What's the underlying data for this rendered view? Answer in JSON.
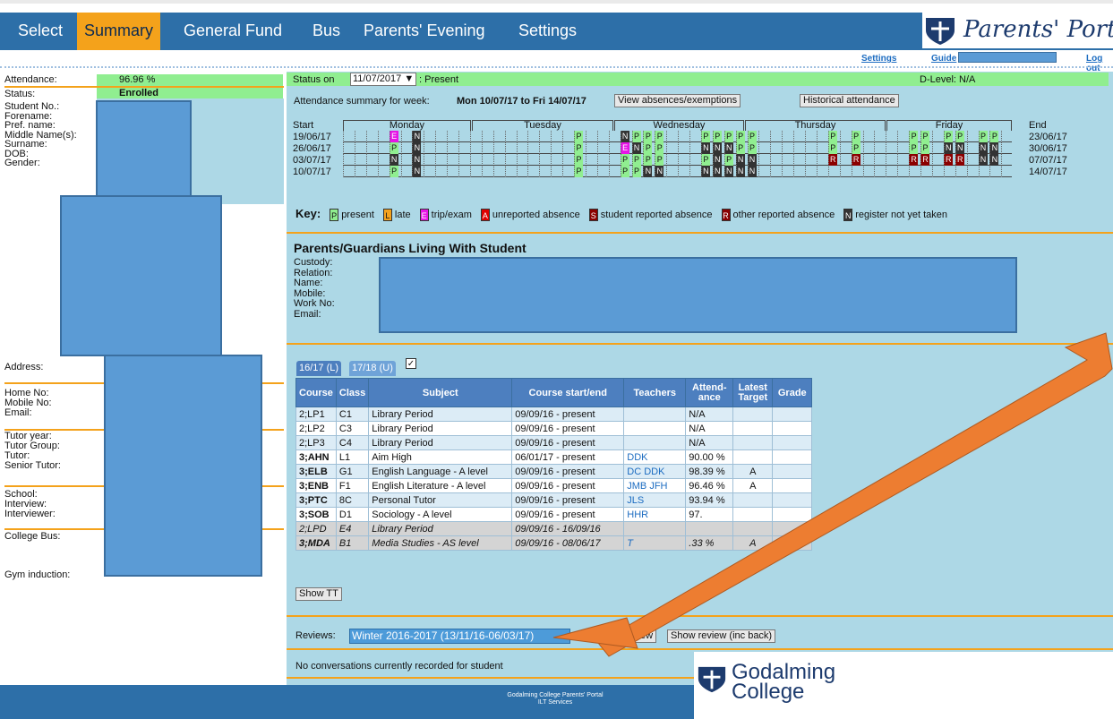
{
  "nav": {
    "items": [
      "Select",
      "Summary",
      "General Fund",
      "Bus",
      "Parents' Evening",
      "Settings"
    ],
    "active": "Summary"
  },
  "brand": {
    "title": "Parents' Portal"
  },
  "sublinks": {
    "settings": "Settings",
    "guide": "Guide",
    "logout": "Log out"
  },
  "student": {
    "attendance_label": "Attendance:",
    "attendance_value": "96.96 %",
    "status_label": "Status:",
    "status_value": "Enrolled",
    "labels1": [
      "Student No.:",
      "Forename:",
      "Pref. name:",
      "Middle Name(s):",
      "Surname:",
      "DOB:",
      "Gender:"
    ],
    "address_label": "Address:",
    "labels2": [
      "Home No:",
      "Mobile No:",
      "Email:",
      "Tutor year:",
      "Tutor Group:",
      "Tutor:",
      "Senior Tutor:",
      "School:",
      "Interview:",
      "Interviewer:",
      "College Bus:"
    ],
    "gym_label": "Gym induction:"
  },
  "status": {
    "prefix": "Status on",
    "date": "11/07/2017",
    "suffix": ": Present",
    "dlevel": "D-Level: N/A"
  },
  "attendance_summary": {
    "label": "Attendance summary for week:",
    "week": "Mon 10/07/17 to Fri 14/07/17",
    "btn_absences": "View absences/exemptions",
    "btn_historical": "Historical attendance"
  },
  "grid": {
    "start": "Start",
    "end": "End",
    "days": [
      "Monday",
      "Tuesday",
      "Wednesday",
      "Thursday",
      "Friday"
    ],
    "rows": [
      {
        "start": "19/06/17",
        "end": "23/06/17",
        "cells": {
          "4": "E",
          "6": "N",
          "20": "P",
          "24": "N",
          "25": "P",
          "26": "P",
          "27": "P",
          "31": "P",
          "32": "P",
          "33": "P",
          "34": "P",
          "35": "P",
          "42": "P",
          "44": "P",
          "49": "P",
          "50": "P",
          "52": "P",
          "53": "P",
          "55": "P",
          "56": "P"
        }
      },
      {
        "start": "26/06/17",
        "end": "30/06/17",
        "cells": {
          "4": "P",
          "6": "N",
          "20": "P",
          "24": "E",
          "25": "N",
          "26": "P",
          "27": "P",
          "31": "N",
          "32": "N",
          "33": "N",
          "34": "P",
          "35": "P",
          "42": "P",
          "44": "P",
          "49": "P",
          "50": "P",
          "52": "N",
          "53": "N",
          "55": "N",
          "56": "N"
        }
      },
      {
        "start": "03/07/17",
        "end": "07/07/17",
        "cells": {
          "4": "N",
          "6": "N",
          "20": "P",
          "24": "P",
          "25": "P",
          "26": "P",
          "27": "P",
          "31": "P",
          "32": "N",
          "33": "P",
          "34": "N",
          "35": "N",
          "42": "R",
          "44": "R",
          "49": "R",
          "50": "R",
          "52": "R",
          "53": "R",
          "55": "N",
          "56": "N"
        }
      },
      {
        "start": "10/07/17",
        "end": "14/07/17",
        "cells": {
          "4": "P",
          "6": "N",
          "20": "P",
          "24": "P",
          "25": "P",
          "26": "N",
          "27": "N",
          "31": "N",
          "32": "N",
          "33": "N",
          "34": "N",
          "35": "N"
        }
      }
    ]
  },
  "key": {
    "title": "Key:",
    "items": [
      {
        "code": "P",
        "label": "present",
        "color": "#90ee90"
      },
      {
        "code": "L",
        "label": "late",
        "color": "#f4a21b"
      },
      {
        "code": "E",
        "label": "trip/exam",
        "color": "#e614e6"
      },
      {
        "code": "A",
        "label": "unreported absence",
        "color": "#e00000"
      },
      {
        "code": "S",
        "label": "student reported absence",
        "color": "#8b0000"
      },
      {
        "code": "R",
        "label": "other reported absence",
        "color": "#8b0000"
      },
      {
        "code": "N",
        "label": "register not yet taken",
        "color": "#333333"
      }
    ]
  },
  "guardians": {
    "title": "Parents/Guardians Living With Student",
    "labels": [
      "Custody:",
      "Relation:",
      "Name:",
      "Mobile:",
      "Work No:",
      "Email:"
    ]
  },
  "courses": {
    "tabs": [
      "16/17 (L)",
      "17/18 (U)"
    ],
    "headers": [
      "Course",
      "Class",
      "Subject",
      "Course start/end",
      "Teachers",
      "Attend-ance",
      "Latest Target",
      "Grade"
    ],
    "rows": [
      {
        "course": "2;LP1",
        "class": "C1",
        "subject": "Library Period",
        "dates": "09/09/16 - present",
        "teachers": "",
        "attendance": "N/A",
        "target": "",
        "grade": "",
        "style": "alt"
      },
      {
        "course": "2;LP2",
        "class": "C3",
        "subject": "Library Period",
        "dates": "09/09/16 - present",
        "teachers": "",
        "attendance": "N/A",
        "target": "",
        "grade": "",
        "style": "w"
      },
      {
        "course": "2;LP3",
        "class": "C4",
        "subject": "Library Period",
        "dates": "09/09/16 - present",
        "teachers": "",
        "attendance": "N/A",
        "target": "",
        "grade": "",
        "style": "alt"
      },
      {
        "course": "3;AHN",
        "class": "L1",
        "subject": "Aim High",
        "dates": "06/01/17 - present",
        "teachers": "DDK",
        "attendance": "90.00 %",
        "target": "",
        "grade": "",
        "style": "w",
        "bold": true
      },
      {
        "course": "3;ELB",
        "class": "G1",
        "subject": "English Language - A level",
        "dates": "09/09/16 - present",
        "teachers": "DC DDK",
        "attendance": "98.39 %",
        "target": "A",
        "grade": "",
        "style": "alt",
        "bold": true
      },
      {
        "course": "3;ENB",
        "class": "F1",
        "subject": "English Literature - A level",
        "dates": "09/09/16 - present",
        "teachers": "JMB JFH",
        "attendance": "96.46 %",
        "target": "A",
        "grade": "",
        "style": "w",
        "bold": true
      },
      {
        "course": "3;PTC",
        "class": "8C",
        "subject": "Personal Tutor",
        "dates": "09/09/16 - present",
        "teachers": "JLS",
        "attendance": "93.94 %",
        "target": "",
        "grade": "",
        "style": "alt",
        "bold": true
      },
      {
        "course": "3;SOB",
        "class": "D1",
        "subject": "Sociology - A level",
        "dates": "09/09/16 - present",
        "teachers": "HHR",
        "attendance": "97.",
        "target": "",
        "grade": "",
        "style": "w",
        "bold": true
      },
      {
        "course": "2;LPD",
        "class": "E4",
        "subject": "Library Period",
        "dates": "09/09/16 - 16/09/16",
        "teachers": "",
        "attendance": "",
        "target": "",
        "grade": "",
        "style": "g"
      },
      {
        "course": "3;MDA",
        "class": "B1",
        "subject": "Media Studies - AS level",
        "dates": "09/09/16 - 08/06/17",
        "teachers": "T",
        "attendance": ".33 %",
        "target": "A",
        "grade": "",
        "style": "g",
        "bold": true
      }
    ],
    "show_tt": "Show TT"
  },
  "reviews": {
    "label": "Reviews:",
    "selected": "Winter 2016-2017 (13/11/16-06/03/17)",
    "btn_show": "how review",
    "btn_show_back": "Show review (inc back)"
  },
  "conversations": {
    "text": "No conversations currently recorded for student"
  },
  "footer": {
    "line1": "Godalming College Parents' Portal",
    "line2": "ILT Services"
  },
  "logo": {
    "line1": "Godalming",
    "line2": "College"
  },
  "colors": {
    "nav": "#2d6fa8",
    "active": "#f4a21b",
    "panel": "#add8e6",
    "status": "#90ee90",
    "arrow": "#ed7d31"
  }
}
